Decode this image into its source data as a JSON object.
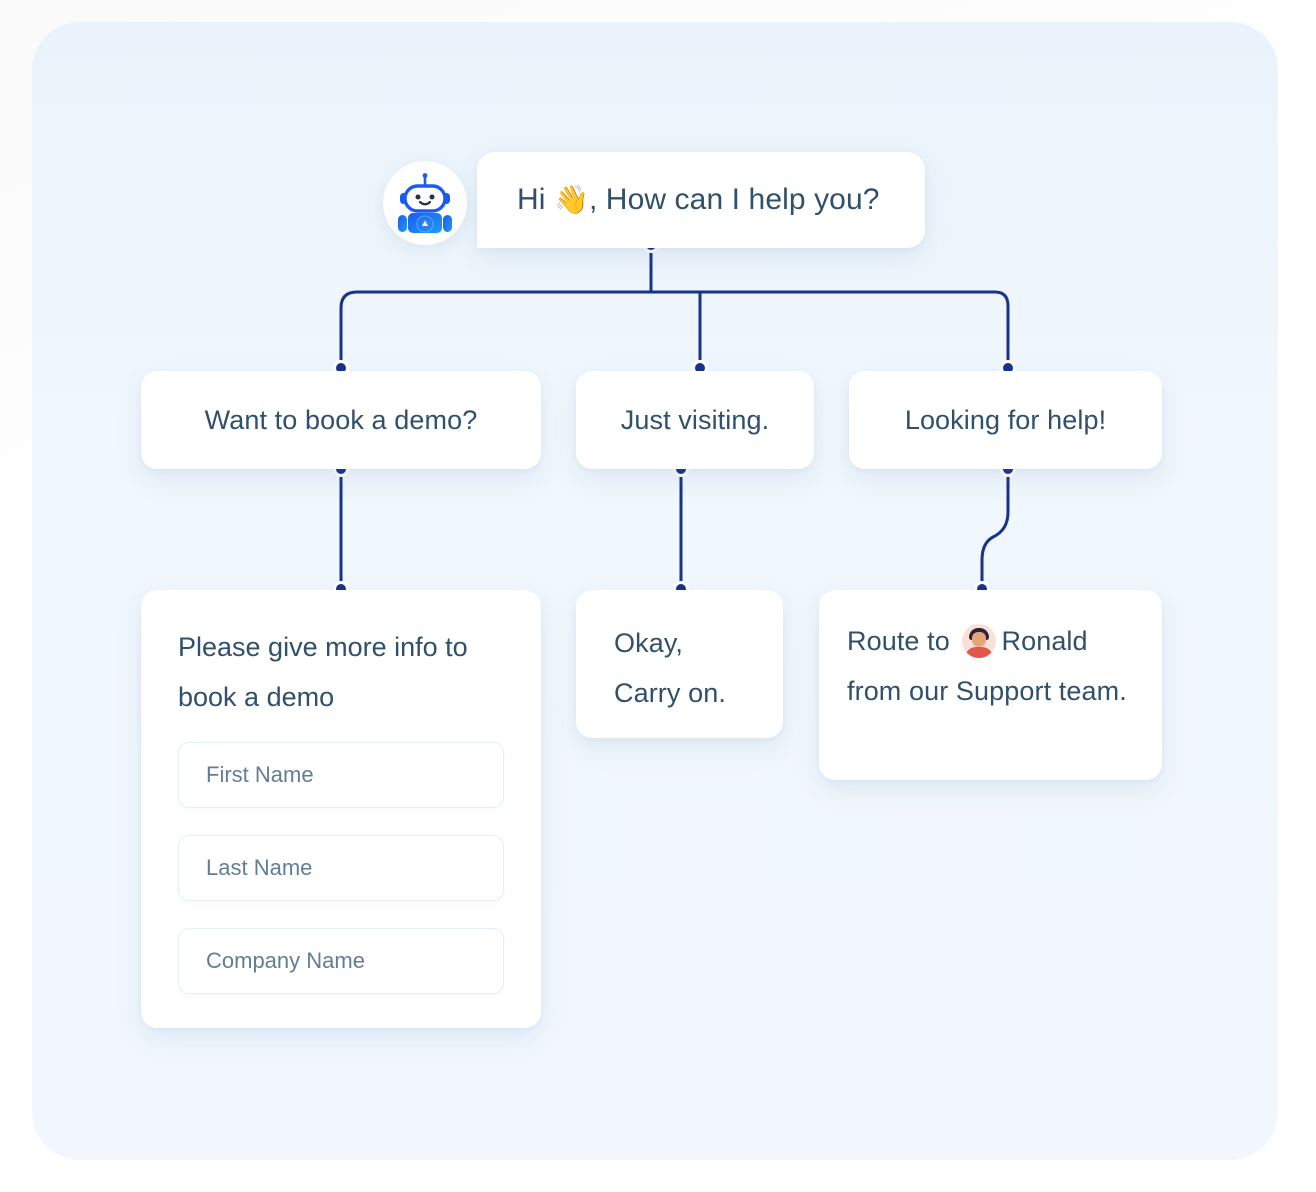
{
  "canvas": {
    "background_color": "#f0f7fd",
    "page_background": "#ffffff"
  },
  "colors": {
    "connector": "#17338c",
    "node_text": "#31506b",
    "placeholder_text": "#647d96",
    "card_background": "#ffffff",
    "field_border": "#e4eef8",
    "bot_blue": "#1b5bf0"
  },
  "bot": {
    "avatar_icon": "robot-avatar-icon"
  },
  "greeting": {
    "text_before": "Hi ",
    "emoji": "👋",
    "text_after": ", How can I help you?"
  },
  "options": [
    {
      "id": "demo",
      "label": "Want to book a demo?"
    },
    {
      "id": "visit",
      "label": "Just visiting."
    },
    {
      "id": "help",
      "label": "Looking for help!"
    }
  ],
  "form_card": {
    "heading": "Please give more info to book a demo",
    "fields": [
      {
        "id": "first-name",
        "placeholder": "First Name",
        "value": ""
      },
      {
        "id": "last-name",
        "placeholder": "Last Name",
        "value": ""
      },
      {
        "id": "company-name",
        "placeholder": "Company Name",
        "value": ""
      }
    ]
  },
  "okay_card": {
    "line1": "Okay,",
    "line2": "Carry on."
  },
  "route_card": {
    "text_before": "Route to ",
    "agent_avatar_icon": "agent-avatar-icon",
    "agent_name": "Ronald",
    "text_after": " from  our Support team."
  }
}
